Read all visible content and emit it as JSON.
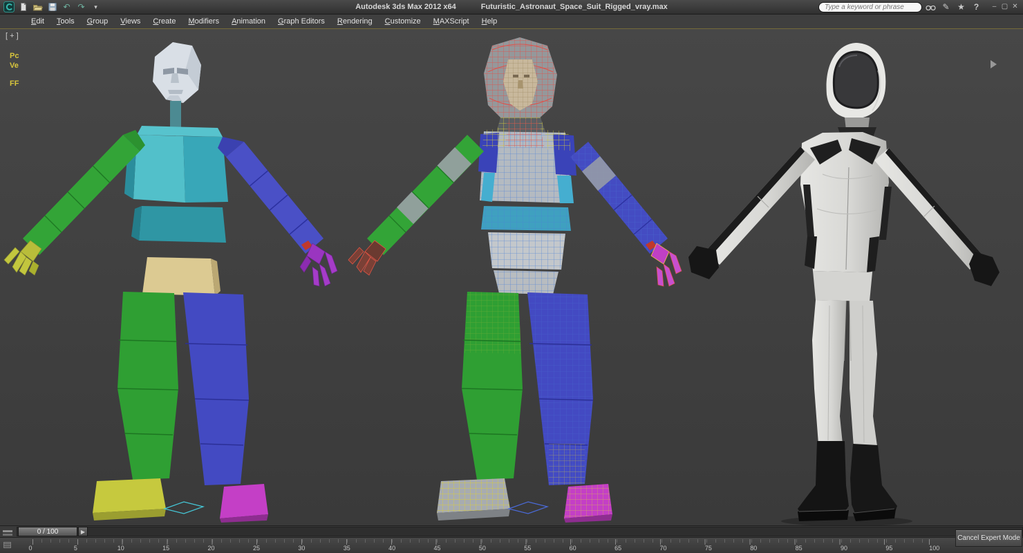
{
  "titlebar": {
    "app_title": "Autodesk 3ds Max  2012 x64",
    "file_title": "Futuristic_Astronaut_Space_Suit_Rigged_vray.max",
    "search_placeholder": "Type a keyword or phrase",
    "window_controls": {
      "minimize": "–",
      "maximize": "▢",
      "close": "✕"
    }
  },
  "menubar": {
    "items": [
      {
        "label": "Edit"
      },
      {
        "label": "Tools"
      },
      {
        "label": "Group"
      },
      {
        "label": "Views"
      },
      {
        "label": "Create"
      },
      {
        "label": "Modifiers"
      },
      {
        "label": "Animation"
      },
      {
        "label": "Graph Editors"
      },
      {
        "label": "Rendering"
      },
      {
        "label": "Customize"
      },
      {
        "label": "MAXScript"
      },
      {
        "label": "Help"
      }
    ]
  },
  "viewport": {
    "corner_label": "[ + ]",
    "side_labels": [
      "Pc",
      "Ve",
      "FF"
    ],
    "models": [
      "segmented-lowpoly-rig",
      "skinned-wireframe-overlay",
      "textured-white-astronaut-suit"
    ]
  },
  "timeline": {
    "frame_display": "0 / 100",
    "tick_labels": [
      "0",
      "5",
      "10",
      "15",
      "20",
      "25",
      "30",
      "35",
      "40",
      "45",
      "50",
      "55",
      "60",
      "65",
      "70",
      "75",
      "80",
      "85",
      "90",
      "95",
      "100"
    ]
  },
  "expert_mode": {
    "cancel_button_label": "Cancel Expert Mode"
  },
  "icons": {
    "app-logo": "3ds-max-swirl",
    "new-scene": "page",
    "open-file": "folder",
    "save-file": "floppy",
    "undo": "↶",
    "redo": "↷",
    "toolbar-overflow": "▾",
    "search-binoculars": "binoculars",
    "communication-center": "pen",
    "favorites": "star",
    "infocenter-help": "?",
    "viewport-nav-arrow": "▶",
    "timeline-options": "list",
    "next-frame": "▸",
    "trackbar-options": "grid"
  },
  "colors": {
    "titlebar_bg": "#3b3b3b",
    "menubar_bg": "#3f3f3f",
    "viewport_bg_top": "#474747",
    "viewport_bg_bottom": "#3a3a3a",
    "viewport_active_border": "#756a38",
    "viewport_label_yellow": "#d8c53c",
    "logo_teal": "#35b5ab",
    "lowpoly_head": "#d9dfe6",
    "lowpoly_chest": "#3fb2c1",
    "lowpoly_abdomen": "#2f96a4",
    "lowpoly_pelvis": "#dcca92",
    "lowpoly_arm_left": "#33a437",
    "lowpoly_arm_right": "#4a50c6",
    "lowpoly_hand_left": "#b9bd3a",
    "lowpoly_hand_right": "#9a35c0",
    "lowpoly_leg_left": "#2f9f33",
    "lowpoly_leg_right": "#434ac2",
    "lowpoly_foot_left": "#c6c93e",
    "lowpoly_foot_right": "#c43fc6",
    "wire_red": "#e0524a",
    "wire_blue": "#4a7fd8",
    "wire_yellow": "#d8cc3c",
    "suit_white": "#dcdcd9",
    "suit_black": "#1a1a1a"
  }
}
